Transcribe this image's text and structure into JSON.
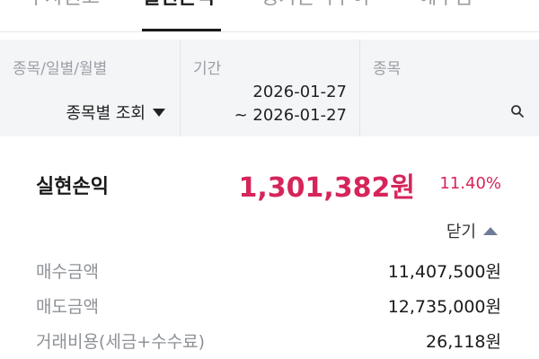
{
  "tabs": [
    {
      "label": "투자원고"
    },
    {
      "label": "실현손익"
    },
    {
      "label": "평가손익추이"
    },
    {
      "label": "예수금"
    }
  ],
  "filter": {
    "col1_label": "종목/일별/월별",
    "col1_value": "종목별 조회",
    "col2_label": "기간",
    "date_from": "2026-01-27",
    "date_to": "~ 2026-01-27",
    "col3_label": "종목"
  },
  "summary": {
    "title": "실현손익",
    "amount": "1,301,382원",
    "rate": "11.40%",
    "collapse_label": "닫기"
  },
  "details": [
    {
      "label": "매수금액",
      "value": "11,407,500원"
    },
    {
      "label": "매도금액",
      "value": "12,735,000원"
    },
    {
      "label": "거래비용(세금+수수료)",
      "value": "26,118원"
    }
  ],
  "colors": {
    "accent": "#d6255a",
    "filter_bg": "#f4f5f7",
    "caret_up": "#6e7d97"
  }
}
